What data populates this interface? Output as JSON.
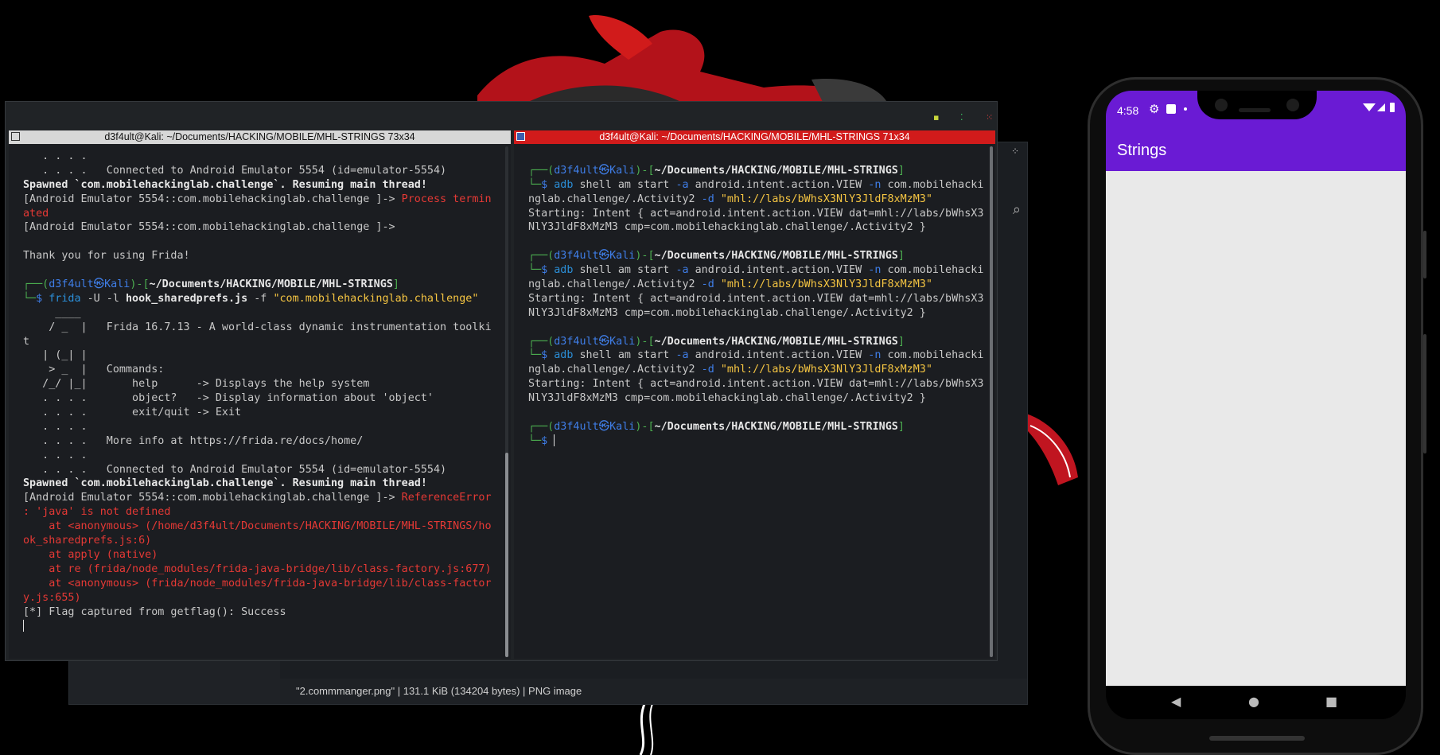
{
  "colors": {
    "desktop_bg": "#000000",
    "terminal_bg": "#1b1d21",
    "active_title_bg": "#d11b1b",
    "inactive_title_bg": "#d7d7d7",
    "prompt_green": "#4caf50",
    "prompt_blue": "#3f7ee8",
    "error_red": "#e53935",
    "string_yellow": "#f5c542",
    "app_bar_purple": "#6a1bd4"
  },
  "viewer": {
    "status": "\"2.commmanger.png\"  |  131.1 KiB (134204 bytes)  |  PNG image",
    "grid_icon": "grid-icon",
    "search_icon": "search-icon"
  },
  "terminal": {
    "left_title": "d3f4ult@Kali: ~/Documents/HACKING/MOBILE/MHL-STRINGS 73x34",
    "right_title": "d3f4ult@Kali: ~/Documents/HACKING/MOBILE/MHL-STRINGS 71x34",
    "left_lines": [
      {
        "segs": [
          {
            "c": "dim",
            "t": "   . . . ."
          }
        ]
      },
      {
        "segs": [
          {
            "c": "dim",
            "t": "   . . . .   Connected to Android Emulator 5554 (id=emulator-5554)"
          }
        ]
      },
      {
        "segs": [
          {
            "c": "bold",
            "t": "Spawned `com.mobilehackinglab.challenge`. Resuming main thread!"
          }
        ]
      },
      {
        "segs": [
          {
            "c": "dim",
            "t": "[Android Emulator 5554::com.mobilehackinglab.challenge ]-> "
          },
          {
            "c": "r",
            "t": "Process termin"
          }
        ]
      },
      {
        "segs": [
          {
            "c": "r",
            "t": "ated"
          }
        ]
      },
      {
        "segs": [
          {
            "c": "dim",
            "t": "[Android Emulator 5554::com.mobilehackinglab.challenge ]->"
          }
        ]
      },
      {
        "segs": [
          {
            "c": "dim",
            "t": ""
          }
        ]
      },
      {
        "segs": [
          {
            "c": "dim",
            "t": "Thank you for using Frida!"
          }
        ]
      },
      {
        "segs": [
          {
            "c": "dim",
            "t": ""
          }
        ]
      },
      {
        "segs": [
          {
            "c": "g",
            "t": "┌──("
          },
          {
            "c": "b",
            "t": "d3f4ult㉿Kali"
          },
          {
            "c": "g",
            "t": ")-["
          },
          {
            "c": "w",
            "t": "~/Documents/HACKING/MOBILE/MHL-STRINGS"
          },
          {
            "c": "g",
            "t": "]"
          }
        ]
      },
      {
        "segs": [
          {
            "c": "g",
            "t": "└─"
          },
          {
            "c": "b",
            "t": "$ "
          },
          {
            "c": "cy",
            "t": "frida "
          },
          {
            "c": "dim",
            "t": "-U -l "
          },
          {
            "c": "w",
            "t": "hook_sharedprefs.js "
          },
          {
            "c": "dim",
            "t": "-f "
          },
          {
            "c": "y",
            "t": "\"com.mobilehackinglab.challenge\""
          }
        ]
      },
      {
        "segs": [
          {
            "c": "dim",
            "t": "     ____"
          }
        ]
      },
      {
        "segs": [
          {
            "c": "dim",
            "t": "    / _  |   Frida 16.7.13 - A world-class dynamic instrumentation toolki"
          }
        ]
      },
      {
        "segs": [
          {
            "c": "dim",
            "t": "t"
          }
        ]
      },
      {
        "segs": [
          {
            "c": "dim",
            "t": "   | (_| |"
          }
        ]
      },
      {
        "segs": [
          {
            "c": "dim",
            "t": "    > _  |   Commands:"
          }
        ]
      },
      {
        "segs": [
          {
            "c": "dim",
            "t": "   /_/ |_|       help      -> Displays the help system"
          }
        ]
      },
      {
        "segs": [
          {
            "c": "dim",
            "t": "   . . . .       object?   -> Display information about 'object'"
          }
        ]
      },
      {
        "segs": [
          {
            "c": "dim",
            "t": "   . . . .       exit/quit -> Exit"
          }
        ]
      },
      {
        "segs": [
          {
            "c": "dim",
            "t": "   . . . ."
          }
        ]
      },
      {
        "segs": [
          {
            "c": "dim",
            "t": "   . . . .   More info at https://frida.re/docs/home/"
          }
        ]
      },
      {
        "segs": [
          {
            "c": "dim",
            "t": "   . . . ."
          }
        ]
      },
      {
        "segs": [
          {
            "c": "dim",
            "t": "   . . . .   Connected to Android Emulator 5554 (id=emulator-5554)"
          }
        ]
      },
      {
        "segs": [
          {
            "c": "bold",
            "t": "Spawned `com.mobilehackinglab.challenge`. Resuming main thread!"
          }
        ]
      },
      {
        "segs": [
          {
            "c": "dim",
            "t": "[Android Emulator 5554::com.mobilehackinglab.challenge ]-> "
          },
          {
            "c": "r",
            "t": "ReferenceError"
          }
        ]
      },
      {
        "segs": [
          {
            "c": "r",
            "t": ": 'java' is not defined"
          }
        ]
      },
      {
        "segs": [
          {
            "c": "r",
            "t": "    at <anonymous> (/home/d3f4ult/Documents/HACKING/MOBILE/MHL-STRINGS/ho"
          }
        ]
      },
      {
        "segs": [
          {
            "c": "r",
            "t": "ok_sharedprefs.js:6)"
          }
        ]
      },
      {
        "segs": [
          {
            "c": "r",
            "t": "    at apply (native)"
          }
        ]
      },
      {
        "segs": [
          {
            "c": "r",
            "t": "    at re (frida/node_modules/frida-java-bridge/lib/class-factory.js:677)"
          }
        ]
      },
      {
        "segs": [
          {
            "c": "r",
            "t": "    at <anonymous> (frida/node_modules/frida-java-bridge/lib/class-factor"
          }
        ]
      },
      {
        "segs": [
          {
            "c": "r",
            "t": "y.js:655)"
          }
        ]
      },
      {
        "segs": [
          {
            "c": "dim",
            "t": "[*] Flag captured from getflag(): Success"
          }
        ]
      },
      {
        "segs": [
          {
            "c": "cursor",
            "t": ""
          }
        ]
      }
    ],
    "right_lines": [
      {
        "segs": [
          {
            "c": "dim",
            "t": ""
          }
        ]
      },
      {
        "segs": [
          {
            "c": "g",
            "t": "┌──("
          },
          {
            "c": "b",
            "t": "d3f4ult㉿Kali"
          },
          {
            "c": "g",
            "t": ")-["
          },
          {
            "c": "w",
            "t": "~/Documents/HACKING/MOBILE/MHL-STRINGS"
          },
          {
            "c": "g",
            "t": "]"
          }
        ]
      },
      {
        "segs": [
          {
            "c": "g",
            "t": "└─"
          },
          {
            "c": "b",
            "t": "$ "
          },
          {
            "c": "cy",
            "t": "adb "
          },
          {
            "c": "dim",
            "t": "shell am start "
          },
          {
            "c": "b",
            "t": "-a "
          },
          {
            "c": "dim",
            "t": "android.intent.action.VIEW "
          },
          {
            "c": "b",
            "t": "-n "
          },
          {
            "c": "dim",
            "t": "com.mobilehacki"
          }
        ]
      },
      {
        "segs": [
          {
            "c": "dim",
            "t": "nglab.challenge/.Activity2 "
          },
          {
            "c": "b",
            "t": "-d "
          },
          {
            "c": "y",
            "t": "\"mhl://labs/bWhsX3NlY3JldF8xMzM3\""
          }
        ]
      },
      {
        "segs": [
          {
            "c": "dim",
            "t": "Starting: Intent { act=android.intent.action.VIEW dat=mhl://labs/bWhsX3"
          }
        ]
      },
      {
        "segs": [
          {
            "c": "dim",
            "t": "NlY3JldF8xMzM3 cmp=com.mobilehackinglab.challenge/.Activity2 }"
          }
        ]
      },
      {
        "segs": [
          {
            "c": "dim",
            "t": ""
          }
        ]
      },
      {
        "segs": [
          {
            "c": "g",
            "t": "┌──("
          },
          {
            "c": "b",
            "t": "d3f4ult㉿Kali"
          },
          {
            "c": "g",
            "t": ")-["
          },
          {
            "c": "w",
            "t": "~/Documents/HACKING/MOBILE/MHL-STRINGS"
          },
          {
            "c": "g",
            "t": "]"
          }
        ]
      },
      {
        "segs": [
          {
            "c": "g",
            "t": "└─"
          },
          {
            "c": "b",
            "t": "$ "
          },
          {
            "c": "cy",
            "t": "adb "
          },
          {
            "c": "dim",
            "t": "shell am start "
          },
          {
            "c": "b",
            "t": "-a "
          },
          {
            "c": "dim",
            "t": "android.intent.action.VIEW "
          },
          {
            "c": "b",
            "t": "-n "
          },
          {
            "c": "dim",
            "t": "com.mobilehacki"
          }
        ]
      },
      {
        "segs": [
          {
            "c": "dim",
            "t": "nglab.challenge/.Activity2 "
          },
          {
            "c": "b",
            "t": "-d "
          },
          {
            "c": "y",
            "t": "\"mhl://labs/bWhsX3NlY3JldF8xMzM3\""
          }
        ]
      },
      {
        "segs": [
          {
            "c": "dim",
            "t": "Starting: Intent { act=android.intent.action.VIEW dat=mhl://labs/bWhsX3"
          }
        ]
      },
      {
        "segs": [
          {
            "c": "dim",
            "t": "NlY3JldF8xMzM3 cmp=com.mobilehackinglab.challenge/.Activity2 }"
          }
        ]
      },
      {
        "segs": [
          {
            "c": "dim",
            "t": ""
          }
        ]
      },
      {
        "segs": [
          {
            "c": "g",
            "t": "┌──("
          },
          {
            "c": "b",
            "t": "d3f4ult㉿Kali"
          },
          {
            "c": "g",
            "t": ")-["
          },
          {
            "c": "w",
            "t": "~/Documents/HACKING/MOBILE/MHL-STRINGS"
          },
          {
            "c": "g",
            "t": "]"
          }
        ]
      },
      {
        "segs": [
          {
            "c": "g",
            "t": "└─"
          },
          {
            "c": "b",
            "t": "$ "
          },
          {
            "c": "cy",
            "t": "adb "
          },
          {
            "c": "dim",
            "t": "shell am start "
          },
          {
            "c": "b",
            "t": "-a "
          },
          {
            "c": "dim",
            "t": "android.intent.action.VIEW "
          },
          {
            "c": "b",
            "t": "-n "
          },
          {
            "c": "dim",
            "t": "com.mobilehacki"
          }
        ]
      },
      {
        "segs": [
          {
            "c": "dim",
            "t": "nglab.challenge/.Activity2 "
          },
          {
            "c": "b",
            "t": "-d "
          },
          {
            "c": "y",
            "t": "\"mhl://labs/bWhsX3NlY3JldF8xMzM3\""
          }
        ]
      },
      {
        "segs": [
          {
            "c": "dim",
            "t": "Starting: Intent { act=android.intent.action.VIEW dat=mhl://labs/bWhsX3"
          }
        ]
      },
      {
        "segs": [
          {
            "c": "dim",
            "t": "NlY3JldF8xMzM3 cmp=com.mobilehackinglab.challenge/.Activity2 }"
          }
        ]
      },
      {
        "segs": [
          {
            "c": "dim",
            "t": ""
          }
        ]
      },
      {
        "segs": [
          {
            "c": "g",
            "t": "┌──("
          },
          {
            "c": "b",
            "t": "d3f4ult㉿Kali"
          },
          {
            "c": "g",
            "t": ")-["
          },
          {
            "c": "w",
            "t": "~/Documents/HACKING/MOBILE/MHL-STRINGS"
          },
          {
            "c": "g",
            "t": "]"
          }
        ]
      },
      {
        "segs": [
          {
            "c": "g",
            "t": "└─"
          },
          {
            "c": "b",
            "t": "$ "
          },
          {
            "c": "cursor",
            "t": ""
          }
        ]
      }
    ]
  },
  "phone": {
    "time": "4:58",
    "status_icons": [
      "gear-icon",
      "square-icon",
      "dot-icon"
    ],
    "system_icons": [
      "wifi-icon",
      "signal-icon",
      "battery-icon"
    ],
    "app_title": "Strings",
    "nav": {
      "back": "◀",
      "home": "●",
      "recents": "■"
    }
  }
}
